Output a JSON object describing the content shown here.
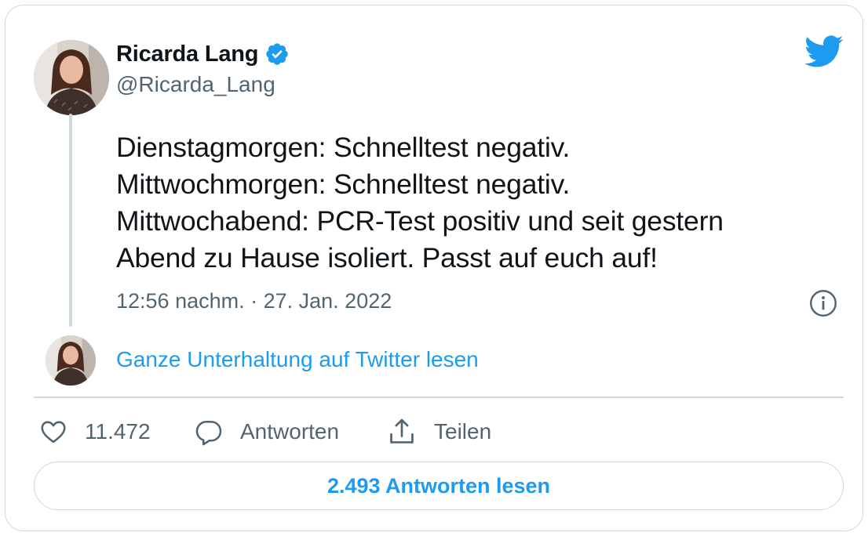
{
  "author": {
    "display_name": "Ricarda Lang",
    "handle": "@Ricarda_Lang",
    "verified": true,
    "avatar_icon": "profile-photo"
  },
  "tweet": {
    "lines": [
      "Dienstagmorgen: Schnelltest negativ.",
      "Mittwochmorgen: Schnelltest negativ.",
      "Mittwochabend: PCR-Test positiv und seit gestern",
      "Abend zu Hause isoliert. Passt auf euch auf!"
    ],
    "timestamp": "12:56 nachm. · 27. Jan. 2022"
  },
  "conversation_link": "Ganze Unterhaltung auf Twitter lesen",
  "actions": {
    "like_count": "11.472",
    "reply_label": "Antworten",
    "share_label": "Teilen"
  },
  "read_replies_label": "2.493 Antworten lesen",
  "colors": {
    "accent": "#1d9bf0",
    "text_primary": "#0f1419",
    "text_secondary": "#536471",
    "border": "#cfd9de"
  }
}
